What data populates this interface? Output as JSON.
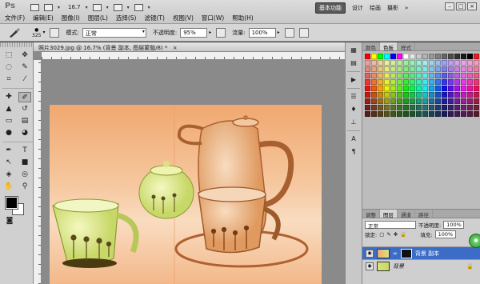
{
  "app": {
    "logo": "Ps",
    "zoom": "16.7",
    "workspaces": [
      "基本功能",
      "设计",
      "绘画",
      "摄影"
    ],
    "workspace_more": "»"
  },
  "menu": [
    "文件(F)",
    "编辑(E)",
    "图像(I)",
    "图层(L)",
    "选择(S)",
    "滤镜(T)",
    "视图(V)",
    "窗口(W)",
    "帮助(H)"
  ],
  "options": {
    "brush_size": "325",
    "mode_label": "模式:",
    "mode_value": "正常",
    "opacity_label": "不透明度:",
    "opacity_value": "95%",
    "flow_label": "流量:",
    "flow_value": "100%"
  },
  "document": {
    "tab_title": "照片3029.jpg @ 16.7% (背景 副本, 图层蒙版/8) *",
    "close": "×"
  },
  "swatch_panel": {
    "tabs": [
      "颜色",
      "色板",
      "样式"
    ],
    "active_tab": 1
  },
  "layers_panel": {
    "tabs": [
      "调整",
      "图层",
      "通道",
      "路径"
    ],
    "blend_mode": "正常",
    "opacity_label": "不透明度:",
    "opacity_value": "100%",
    "lock_label": "锁定:",
    "fill_label": "填充:",
    "fill_value": "100%",
    "layers": [
      {
        "name": "背景 副本",
        "selected": true
      },
      {
        "name": "背景",
        "selected": false
      }
    ]
  },
  "colors": {
    "foreground": "#000000",
    "background": "#ffffff",
    "selection": "#3b6cc8",
    "canvas_tint": "#f0a870"
  }
}
